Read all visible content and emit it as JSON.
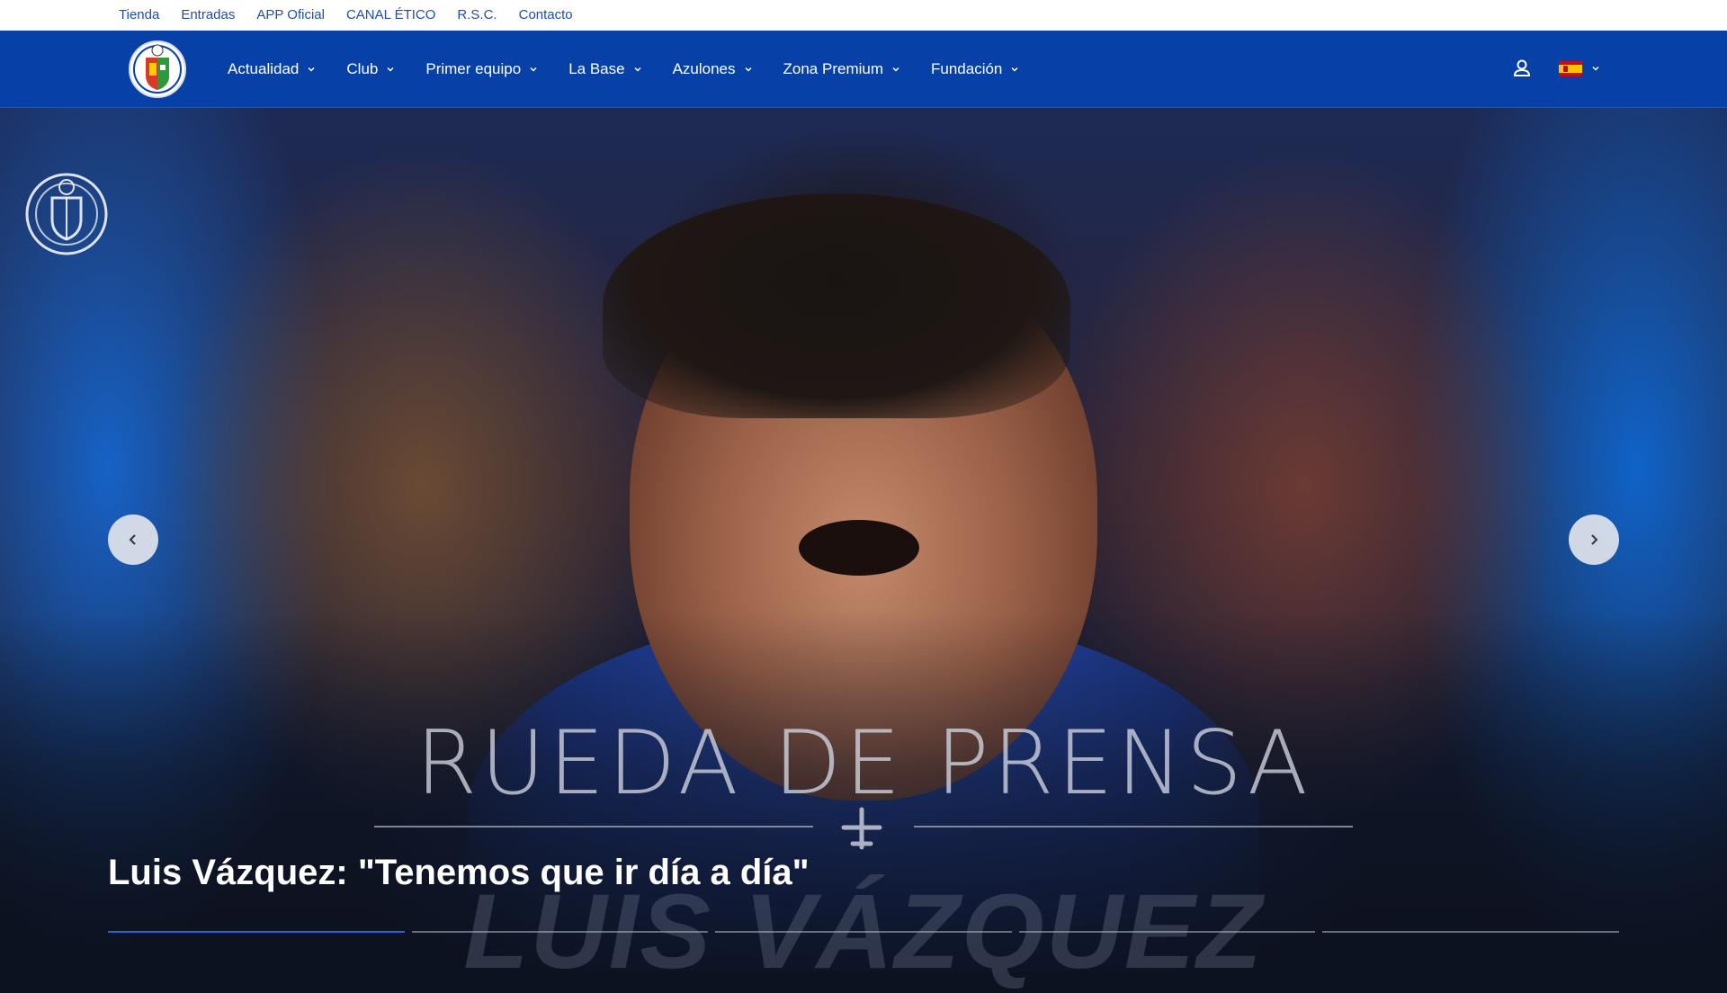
{
  "topbar": {
    "links": [
      "Tienda",
      "Entradas",
      "APP Oficial",
      "CANAL ÉTICO",
      "R.S.C.",
      "Contacto"
    ]
  },
  "nav": {
    "items": [
      "Actualidad",
      "Club",
      "Primer equipo",
      "La Base",
      "Azulones",
      "Zona Premium",
      "Fundación"
    ],
    "icons": {
      "user": "user-icon",
      "language": "spain-flag-icon",
      "dropdown": "chevron-down-icon"
    }
  },
  "hero": {
    "overlay_title": "RUEDA DE PRENSA",
    "overlay_name": "LUIS VÁZQUEZ",
    "headline": "Luis Vázquez: \"Tenemos que ir día a día\"",
    "slides_total": 5,
    "active_slide": 1
  },
  "colors": {
    "nav_bg": "#0741a8",
    "link_blue": "#1e4fae",
    "progress_active": "#2b63d9"
  }
}
